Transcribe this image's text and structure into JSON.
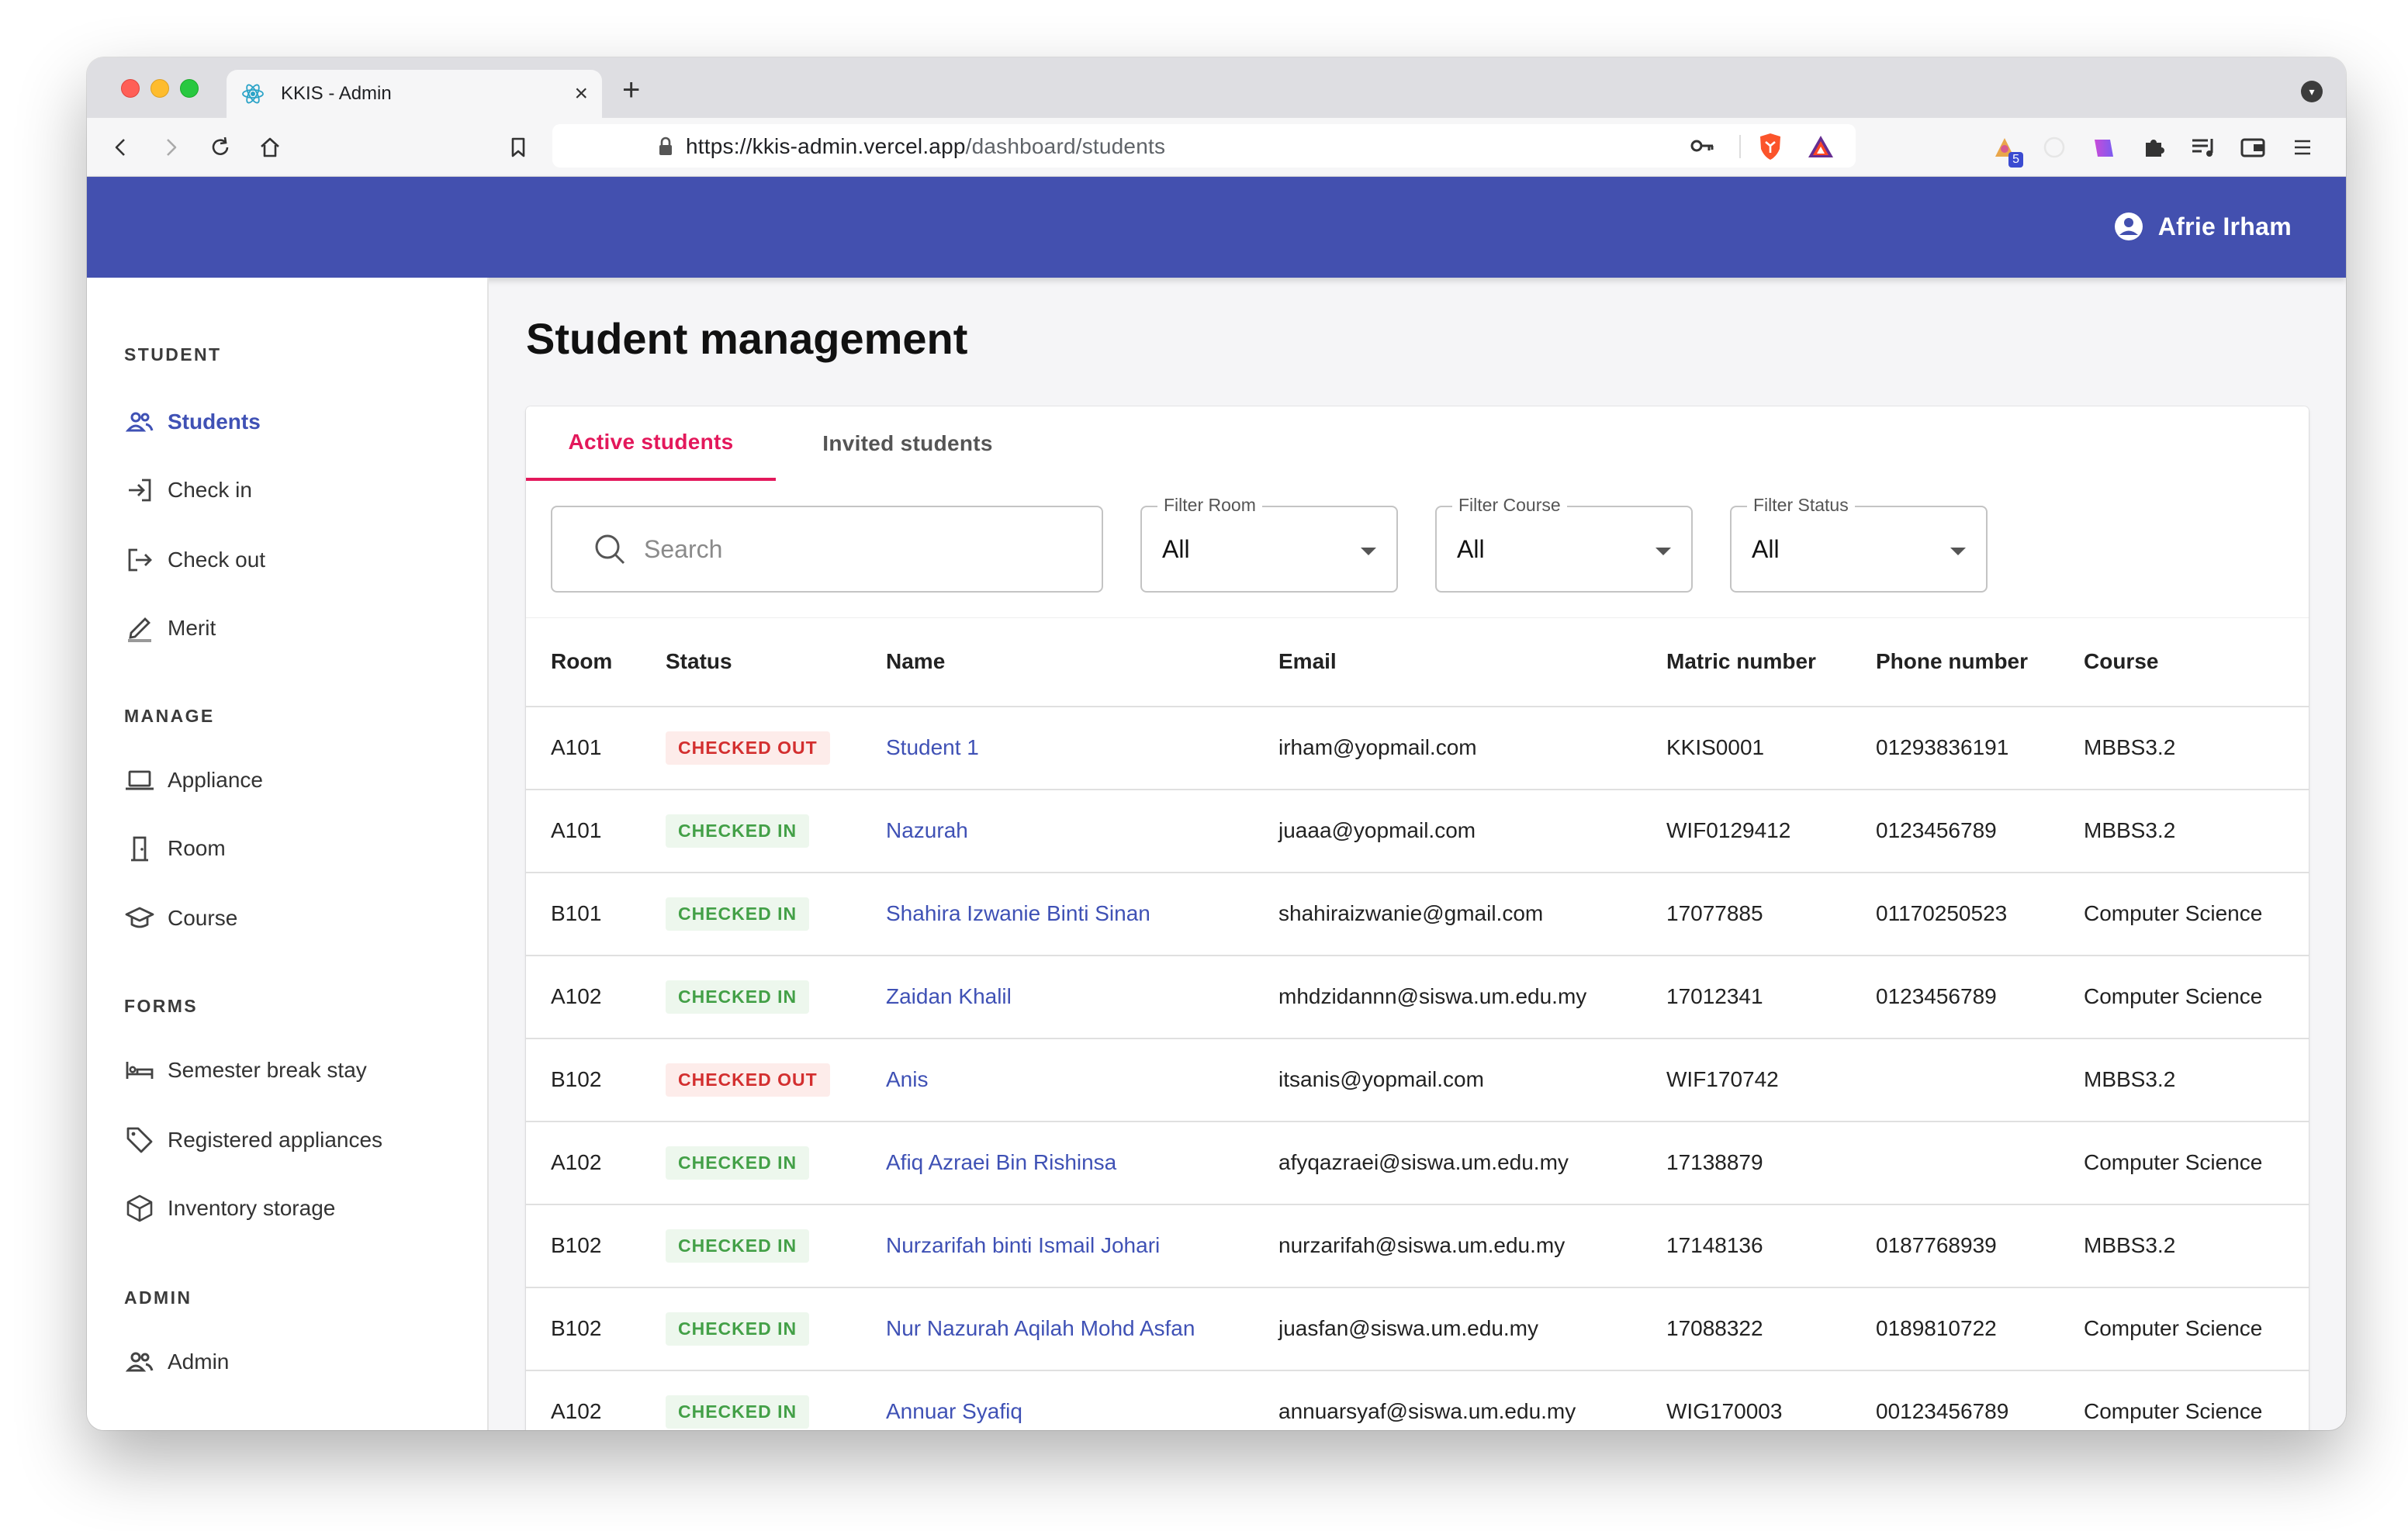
{
  "browser": {
    "tab_title": "KKIS - Admin",
    "tab_close": "×",
    "new_tab": "+",
    "url_host": "https://kkis-admin.vercel.app",
    "url_path": "/dashboard/students",
    "extension_badge": "5"
  },
  "header": {
    "user_name": "Afrie Irham"
  },
  "sidebar": {
    "sections": [
      {
        "title": "STUDENT",
        "items": [
          {
            "label": "Students",
            "icon": "users-icon",
            "active": true
          },
          {
            "label": "Check in",
            "icon": "login-icon"
          },
          {
            "label": "Check out",
            "icon": "logout-icon"
          },
          {
            "label": "Merit",
            "icon": "pencil-icon"
          }
        ]
      },
      {
        "title": "MANAGE",
        "items": [
          {
            "label": "Appliance",
            "icon": "laptop-icon"
          },
          {
            "label": "Room",
            "icon": "door-icon"
          },
          {
            "label": "Course",
            "icon": "graduation-cap-icon"
          }
        ]
      },
      {
        "title": "FORMS",
        "items": [
          {
            "label": "Semester break stay",
            "icon": "bed-icon"
          },
          {
            "label": "Registered appliances",
            "icon": "tag-icon"
          },
          {
            "label": "Inventory storage",
            "icon": "box-icon"
          }
        ]
      },
      {
        "title": "ADMIN",
        "items": [
          {
            "label": "Admin",
            "icon": "users-icon"
          }
        ]
      }
    ]
  },
  "main": {
    "title": "Student management",
    "tabs": [
      "Active students",
      "Invited students"
    ],
    "active_tab": 0,
    "search": {
      "placeholder": "Search",
      "value": ""
    },
    "filters": [
      {
        "label": "Filter Room",
        "value": "All"
      },
      {
        "label": "Filter Course",
        "value": "All"
      },
      {
        "label": "Filter Status",
        "value": "All"
      }
    ],
    "columns": [
      "Room",
      "Status",
      "Name",
      "Email",
      "Matric number",
      "Phone number",
      "Course"
    ],
    "rows": [
      {
        "room": "A101",
        "status": "CHECKED OUT",
        "name": "Student 1",
        "email": "irham@yopmail.com",
        "matric": "KKIS0001",
        "phone": "01293836191",
        "course": "MBBS3.2"
      },
      {
        "room": "A101",
        "status": "CHECKED IN",
        "name": "Nazurah",
        "email": "juaaa@yopmail.com",
        "matric": "WIF0129412",
        "phone": "0123456789",
        "course": "MBBS3.2"
      },
      {
        "room": "B101",
        "status": "CHECKED IN",
        "name": "Shahira Izwanie Binti Sinan",
        "email": "shahiraizwanie@gmail.com",
        "matric": "17077885",
        "phone": "01170250523",
        "course": "Computer Science"
      },
      {
        "room": "A102",
        "status": "CHECKED IN",
        "name": "Zaidan Khalil",
        "email": "mhdzidannn@siswa.um.edu.my",
        "matric": "17012341",
        "phone": "0123456789",
        "course": "Computer Science"
      },
      {
        "room": "B102",
        "status": "CHECKED OUT",
        "name": "Anis",
        "email": "itsanis@yopmail.com",
        "matric": "WIF170742",
        "phone": "",
        "course": "MBBS3.2"
      },
      {
        "room": "A102",
        "status": "CHECKED IN",
        "name": "Afiq Azraei Bin Rishinsa",
        "email": "afyqazraei@siswa.um.edu.my",
        "matric": "17138879",
        "phone": "",
        "course": "Computer Science"
      },
      {
        "room": "B102",
        "status": "CHECKED IN",
        "name": "Nurzarifah binti Ismail Johari",
        "email": "nurzarifah@siswa.um.edu.my",
        "matric": "17148136",
        "phone": "0187768939",
        "course": "MBBS3.2"
      },
      {
        "room": "B102",
        "status": "CHECKED IN",
        "name": "Nur Nazurah Aqilah Mohd Asfan",
        "email": "juasfan@siswa.um.edu.my",
        "matric": "17088322",
        "phone": "0189810722",
        "course": "Computer Science"
      },
      {
        "room": "A102",
        "status": "CHECKED IN",
        "name": "Annuar Syafiq",
        "email": "annuarsyaf@siswa.um.edu.my",
        "matric": "WIG170003",
        "phone": "00123456789",
        "course": "Computer Science"
      }
    ]
  },
  "colors": {
    "appbar": "#4350af",
    "accent": "#3f51b5",
    "tab_active": "#e3185b",
    "checked_out": "#d32f2f",
    "checked_in": "#43a047"
  }
}
